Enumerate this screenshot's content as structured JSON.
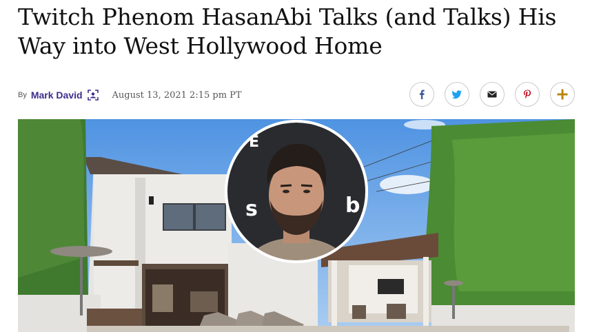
{
  "article": {
    "headline": "Twitch Phenom HasanAbi Talks (and Talks) His Way into West Hollywood Home",
    "byline_prefix": "By",
    "author": "Mark David",
    "date": "August 13, 2021 2:15 pm PT"
  },
  "share_buttons": [
    {
      "icon": "facebook-icon",
      "color": "#3b5998"
    },
    {
      "icon": "twitter-icon",
      "color": "#1da1f2"
    },
    {
      "icon": "email-icon",
      "color": "#222222"
    },
    {
      "icon": "pinterest-icon",
      "color": "#bd081c"
    },
    {
      "icon": "more-share-icon",
      "color": "#b8860b"
    }
  ],
  "colors": {
    "author": "#3d2b8c",
    "headline": "#111111"
  }
}
